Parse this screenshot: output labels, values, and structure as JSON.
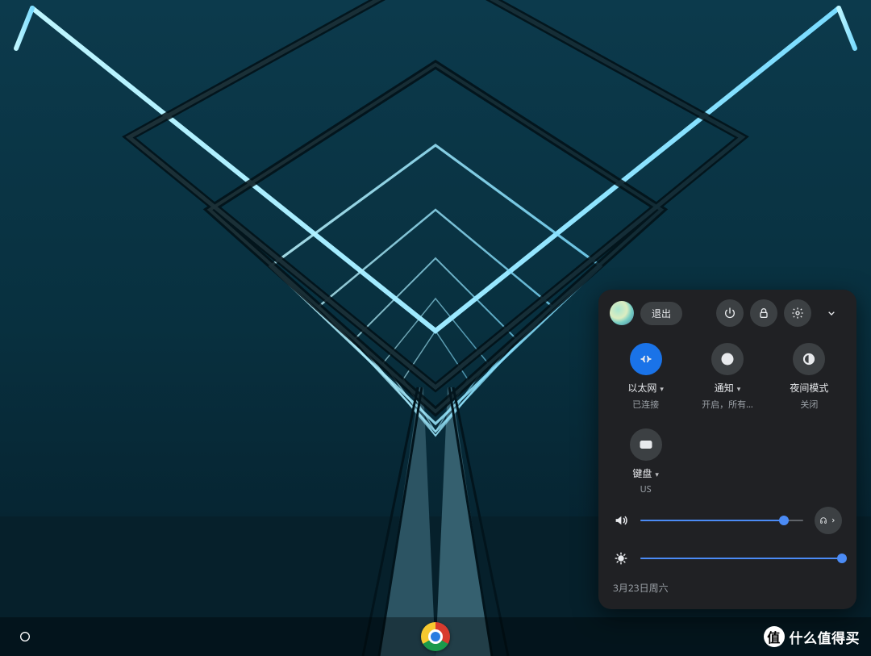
{
  "panel": {
    "exit_label": "退出",
    "toggles": {
      "network": {
        "label": "以太网",
        "sub": "已连接",
        "active": true,
        "has_caret": true
      },
      "notify": {
        "label": "通知",
        "sub": "开启，所有…",
        "active": false,
        "has_caret": true
      },
      "night": {
        "label": "夜间模式",
        "sub": "关闭",
        "active": false,
        "has_caret": false
      },
      "keyboard": {
        "label": "键盘",
        "sub": "US",
        "active": false,
        "has_caret": true
      }
    },
    "volume_percent": 88,
    "brightness_percent": 100,
    "date": "3月23日周六"
  },
  "watermark": {
    "badge": "值",
    "text": "什么值得买"
  },
  "colors": {
    "accent": "#1a73e8",
    "panel_bg": "#202124"
  }
}
